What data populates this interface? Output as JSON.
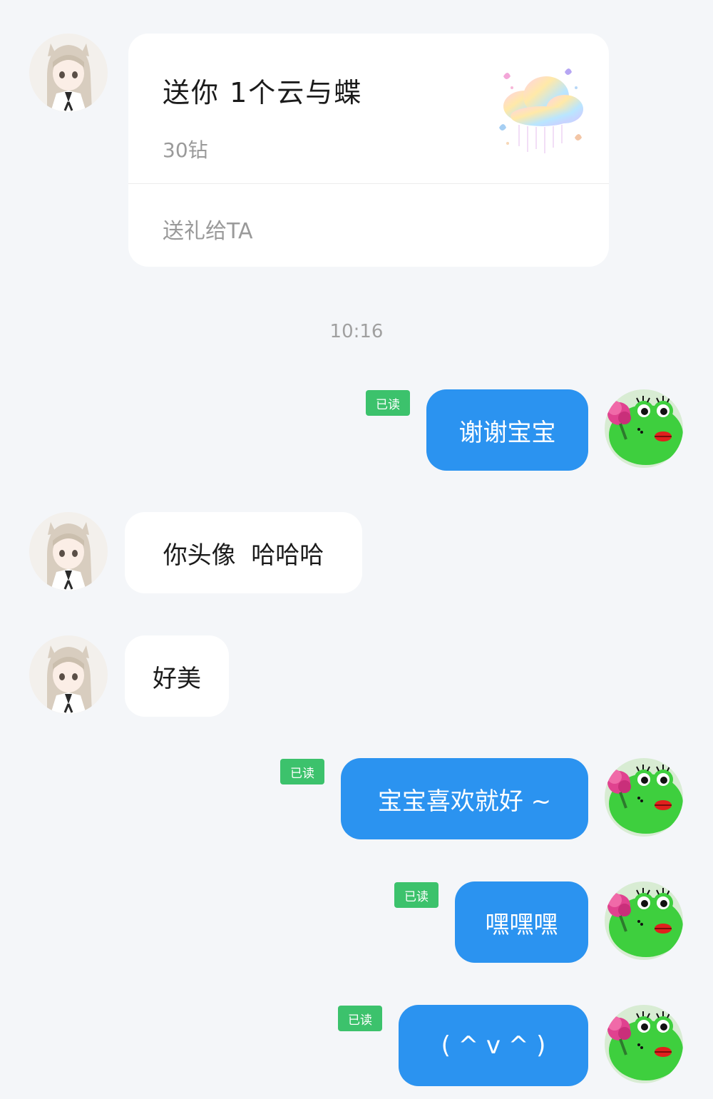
{
  "gift_card": {
    "title": "送你 1个云与蝶",
    "price": "30钻",
    "send_label": "送礼给TA",
    "image_icon": "cloud-butterfly-gift-icon"
  },
  "timestamp": "10:16",
  "read_label": "已读",
  "avatars": {
    "them": "anime-girl-avatar",
    "me": "frog-with-flower-avatar"
  },
  "messages": [
    {
      "from": "me",
      "text": "谢谢宝宝",
      "read": true
    },
    {
      "from": "them",
      "text": "你头像  哈哈哈"
    },
    {
      "from": "them",
      "text": "好美"
    },
    {
      "from": "me",
      "text": "宝宝喜欢就好 ~",
      "read": true
    },
    {
      "from": "me",
      "text": "嘿嘿嘿",
      "read": true
    },
    {
      "from": "me",
      "text": "( ^ v ^ )",
      "read": true
    }
  ],
  "colors": {
    "background": "#f4f6f9",
    "outgoing_bubble": "#2b93f0",
    "incoming_bubble": "#ffffff",
    "read_badge": "#3cc26c"
  }
}
